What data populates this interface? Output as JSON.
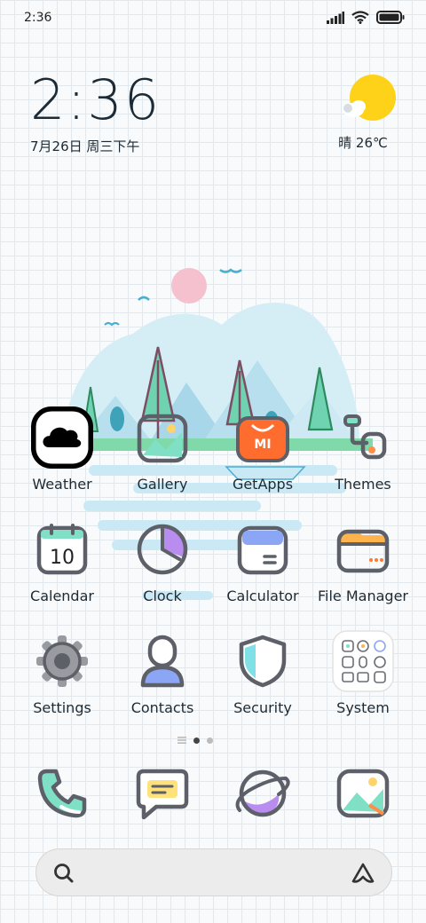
{
  "status_bar": {
    "time": "2:36"
  },
  "clock_widget": {
    "time": "2:36",
    "date": "7月26日 周三下午"
  },
  "weather_widget": {
    "text": "晴 26℃",
    "icon": "sunny-cloud-icon"
  },
  "apps": {
    "row1": [
      {
        "label": "Weather",
        "icon": "cloud-icon"
      },
      {
        "label": "Gallery",
        "icon": "image-icon"
      },
      {
        "label": "GetApps",
        "icon": "shopping-bag-icon"
      },
      {
        "label": "Themes",
        "icon": "paint-roller-icon"
      }
    ],
    "row2": [
      {
        "label": "Calendar",
        "icon": "calendar-icon",
        "day": "10"
      },
      {
        "label": "Clock",
        "icon": "clock-icon"
      },
      {
        "label": "Calculator",
        "icon": "calculator-icon"
      },
      {
        "label": "File Manager",
        "icon": "folder-icon"
      }
    ],
    "row3": [
      {
        "label": "Settings",
        "icon": "gear-icon"
      },
      {
        "label": "Contacts",
        "icon": "person-icon"
      },
      {
        "label": "Security",
        "icon": "shield-icon"
      },
      {
        "label": "System",
        "icon": "folder-grid-icon"
      }
    ]
  },
  "page_indicator": {
    "pages": 2,
    "current": 1
  },
  "dock": [
    "phone-icon",
    "messages-icon",
    "browser-planet-icon",
    "gallery-icon"
  ],
  "colors": {
    "accent_mint": "#7fe0c6",
    "accent_orange": "#ff6d2e",
    "accent_purple": "#b98cf0",
    "accent_blue": "#8ba6f5",
    "outline": "#5d6068"
  }
}
